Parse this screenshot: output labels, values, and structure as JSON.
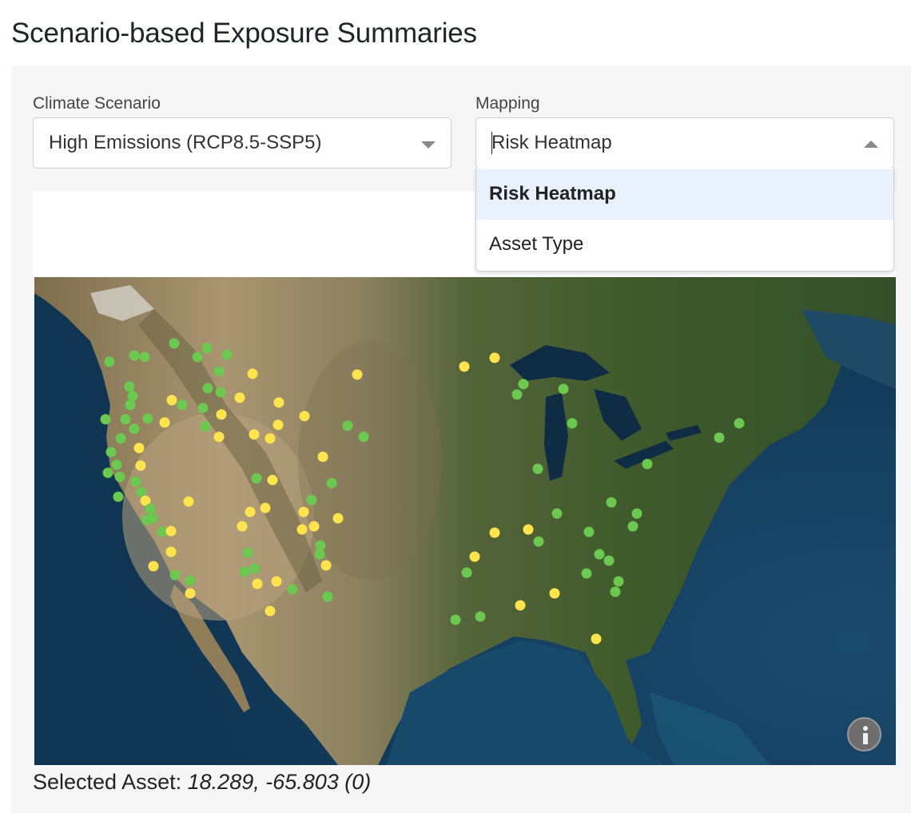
{
  "page": {
    "title": "Scenario-based Exposure Summaries"
  },
  "controls": {
    "scenario": {
      "label": "Climate Scenario",
      "value": "High Emissions (RCP8.5-SSP5)"
    },
    "mapping": {
      "label": "Mapping",
      "value": "Risk Heatmap",
      "is_open": true,
      "options": [
        {
          "label": "Risk Heatmap",
          "selected": true
        },
        {
          "label": "Asset Type",
          "selected": false
        }
      ]
    }
  },
  "map": {
    "region": "Continental United States",
    "basemap": "satellite",
    "marker_colors": {
      "green": "#6bc94f",
      "yellow": "#ffe44d"
    },
    "info_icon": "info-icon"
  },
  "selected_asset": {
    "label": "Selected Asset:",
    "value": "18.289, -65.803 (0)"
  }
}
